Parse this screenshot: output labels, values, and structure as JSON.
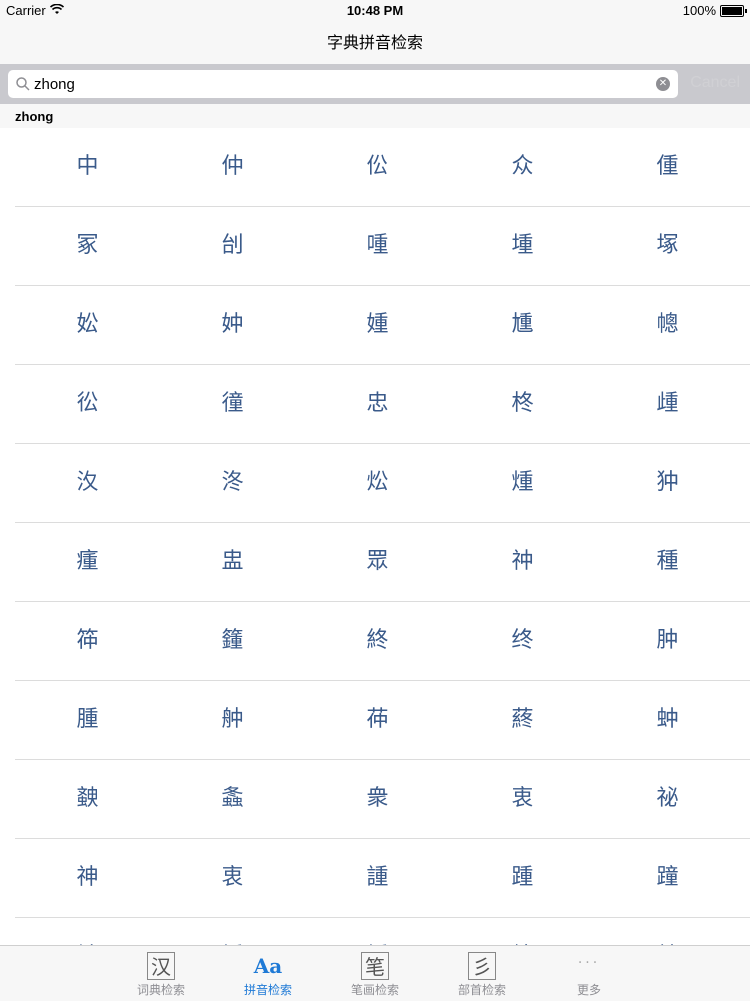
{
  "status_bar": {
    "carrier": "Carrier",
    "time": "10:48 PM",
    "battery": "100%",
    "battery_level": 1.0
  },
  "nav": {
    "title": "字典拼音检索"
  },
  "search": {
    "value": "zhong",
    "cancel_label": "Cancel"
  },
  "section": {
    "title": "zhong"
  },
  "grid": {
    "rows": [
      [
        "中",
        "仲",
        "伀",
        "众",
        "偅"
      ],
      [
        "冢",
        "刣",
        "喠",
        "堹",
        "塚"
      ],
      [
        "妐",
        "妕",
        "媑",
        "尰",
        "幒"
      ],
      [
        "彸",
        "徸",
        "忠",
        "柊",
        "歱"
      ],
      [
        "汷",
        "泈",
        "炂",
        "煄",
        "狆"
      ],
      [
        "瘇",
        "盅",
        "眾",
        "祌",
        "種"
      ],
      [
        "筗",
        "籦",
        "終",
        "终",
        "肿"
      ],
      [
        "腫",
        "舯",
        "茽",
        "蔠",
        "蚛"
      ],
      [
        "螤",
        "螽",
        "衆",
        "衷",
        "祕"
      ],
      [
        "神",
        "衷",
        "諥",
        "踵",
        "蹱"
      ],
      [
        "钟",
        "锺",
        "锺",
        "鐘",
        "鈡"
      ]
    ]
  },
  "tabs": [
    {
      "icon": "汉",
      "label": "词典检索"
    },
    {
      "icon": "Aa",
      "label": "拼音检索",
      "active": true
    },
    {
      "icon": "笔",
      "label": "笔画检索"
    },
    {
      "icon": "彡",
      "label": "部首检索"
    },
    {
      "icon": "···",
      "label": "更多"
    }
  ],
  "colors": {
    "accent": "#1f7ad6",
    "character": "#3a5a8a"
  }
}
